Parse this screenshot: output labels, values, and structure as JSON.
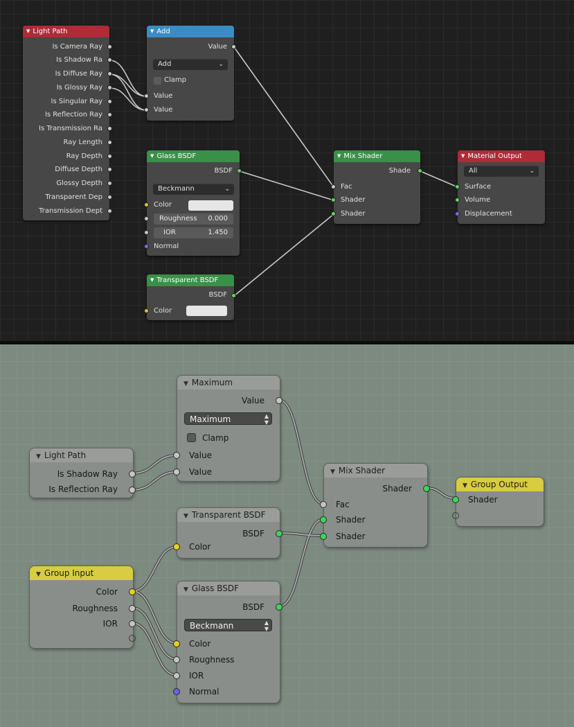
{
  "top": {
    "light_path": {
      "title": "Light Path",
      "outputs": [
        "Is Camera Ray",
        "Is Shadow Ra",
        "Is Diffuse Ray",
        "Is Glossy Ray",
        "Is Singular Ray",
        "Is Reflection Ray",
        "Is Transmission Ra",
        "Ray Length",
        "Ray Depth",
        "Diffuse Depth",
        "Glossy Depth",
        "Transparent Dep",
        "Transmission Dept"
      ]
    },
    "add": {
      "title": "Add",
      "output": "Value",
      "operation": "Add",
      "clamp_label": "Clamp",
      "input1": "Value",
      "input2": "Value"
    },
    "glass": {
      "title": "Glass BSDF",
      "output": "BSDF",
      "distribution": "Beckmann",
      "color_label": "Color",
      "roughness_label": "Roughness",
      "roughness_value": "0.000",
      "ior_label": "IOR",
      "ior_value": "1.450",
      "normal_label": "Normal"
    },
    "transparent": {
      "title": "Transparent BSDF",
      "output": "BSDF",
      "color_label": "Color"
    },
    "mix": {
      "title": "Mix Shader",
      "output": "Shade",
      "fac": "Fac",
      "shader1": "Shader",
      "shader2": "Shader"
    },
    "material_output": {
      "title": "Material Output",
      "target": "All",
      "surface": "Surface",
      "volume": "Volume",
      "displacement": "Displacement"
    }
  },
  "bottom": {
    "maximum": {
      "title": "Maximum",
      "output": "Value",
      "operation": "Maximum",
      "clamp_label": "Clamp",
      "input1": "Value",
      "input2": "Value"
    },
    "light_path": {
      "title": "Light Path",
      "output1": "Is Shadow Ray",
      "output2": "Is Reflection Ray"
    },
    "mix": {
      "title": "Mix Shader",
      "output": "Shader",
      "fac": "Fac",
      "shader1": "Shader",
      "shader2": "Shader"
    },
    "group_output": {
      "title": "Group Output",
      "input": "Shader"
    },
    "transparent": {
      "title": "Transparent BSDF",
      "output": "BSDF",
      "color_label": "Color"
    },
    "group_input": {
      "title": "Group Input",
      "output1": "Color",
      "output2": "Roughness",
      "output3": "IOR"
    },
    "glass": {
      "title": "Glass BSDF",
      "output": "BSDF",
      "distribution": "Beckmann",
      "color_label": "Color",
      "roughness_label": "Roughness",
      "ior_label": "IOR",
      "normal_label": "Normal"
    }
  }
}
